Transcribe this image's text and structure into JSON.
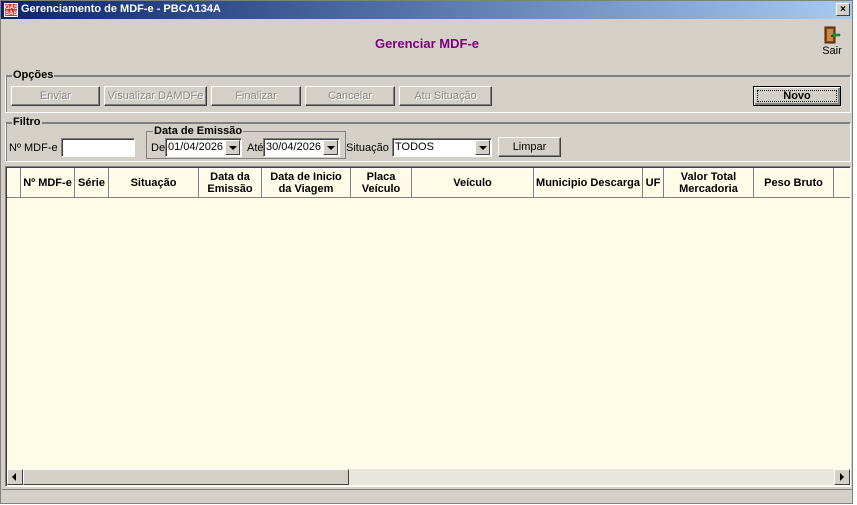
{
  "window": {
    "title": "Gerenciamento de MDF-e - PBCA134A",
    "app_icon_text": "GAS SAS",
    "close_symbol": "×"
  },
  "header": {
    "title": "Gerenciar MDF-e",
    "exit_label": "Sair",
    "exit_icon": "door-exit-icon"
  },
  "opcoes": {
    "legend": "Opções",
    "buttons": {
      "enviar": "Enviar",
      "visualizar": "Visualizar DAMDFe",
      "finalizar": "Finalizar",
      "cancelar": "Cancelar",
      "atu_situacao": "Atu Situação",
      "novo": "Novo"
    }
  },
  "filtro": {
    "legend": "Filtro",
    "numero_label": "Nº MDF-e",
    "numero_value": "",
    "data_emissao": {
      "legend": "Data de Emissão",
      "de_label": "De",
      "de_value": "01/04/2026",
      "ate_label": "Até",
      "ate_value": "30/04/2026"
    },
    "situacao_label": "Situação",
    "situacao_value": "TODOS",
    "limpar_label": "Limpar"
  },
  "grid": {
    "columns": [
      "",
      "Nº MDF-e",
      "Série",
      "Situação",
      "Data da Emissão",
      "Data de Inicio da Viagem",
      "Placa Veículo",
      "Veículo",
      "Municipio Descarga",
      "UF",
      "Valor Total Mercadoria",
      "Peso Bruto",
      ""
    ],
    "rows": []
  },
  "colors": {
    "title_accent": "#800080",
    "grid_background": "#fffbe6",
    "window_face": "#d4d0c8"
  }
}
